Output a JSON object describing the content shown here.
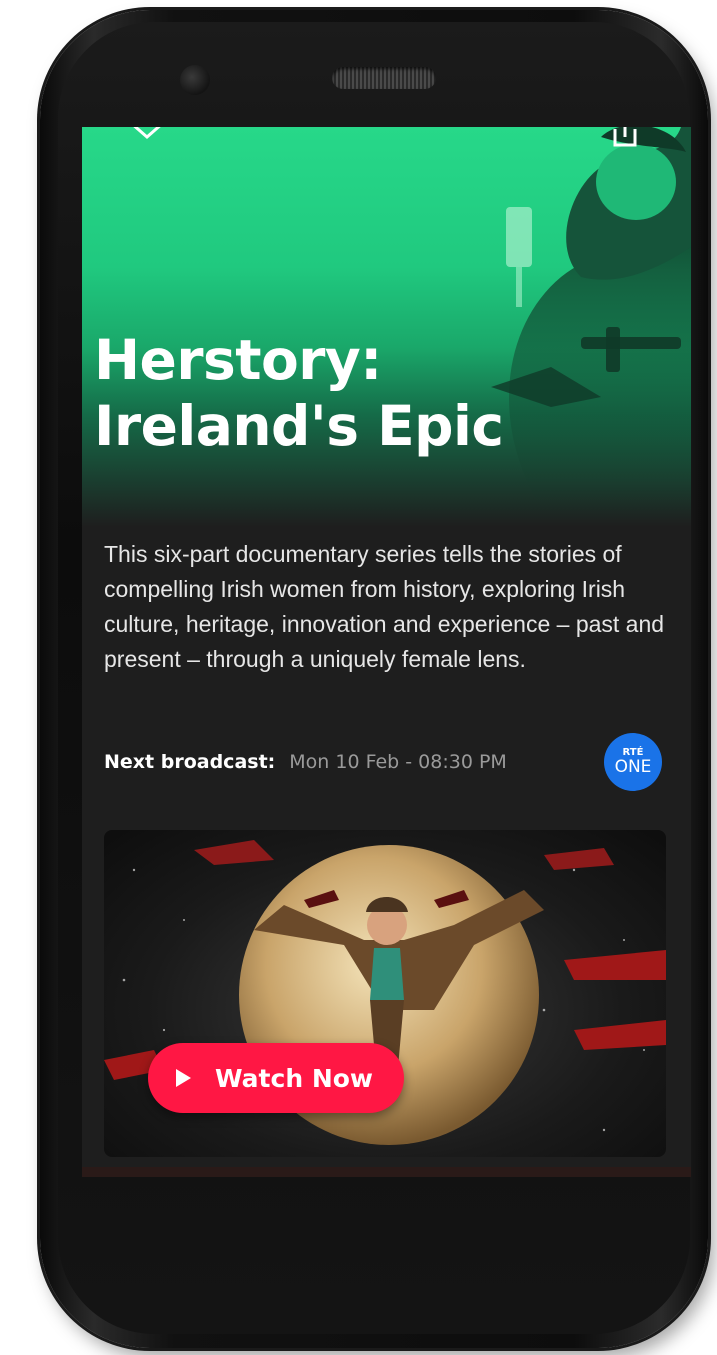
{
  "header": {
    "back_icon": "chevron-down-icon",
    "share_icon": "share-icon"
  },
  "show": {
    "title": "Herstory: Ireland's Epic",
    "description": "This six-part documentary series tells the stories of compelling Irish women from history, exploring Irish culture, heritage, innovation and experience – past and present – through a uniquely female lens."
  },
  "broadcast": {
    "label": "Next broadcast:",
    "value": "Mon 10 Feb - 08:30 PM",
    "channel_top": "RTÉ",
    "channel_bottom": "ONE"
  },
  "promo": {
    "watch_label": "Watch Now",
    "play_icon": "play-icon"
  },
  "colors": {
    "hero_green": "#27d889",
    "background": "#1e1e1e",
    "accent_red": "#ff1744",
    "channel_blue": "#1a73e8"
  }
}
